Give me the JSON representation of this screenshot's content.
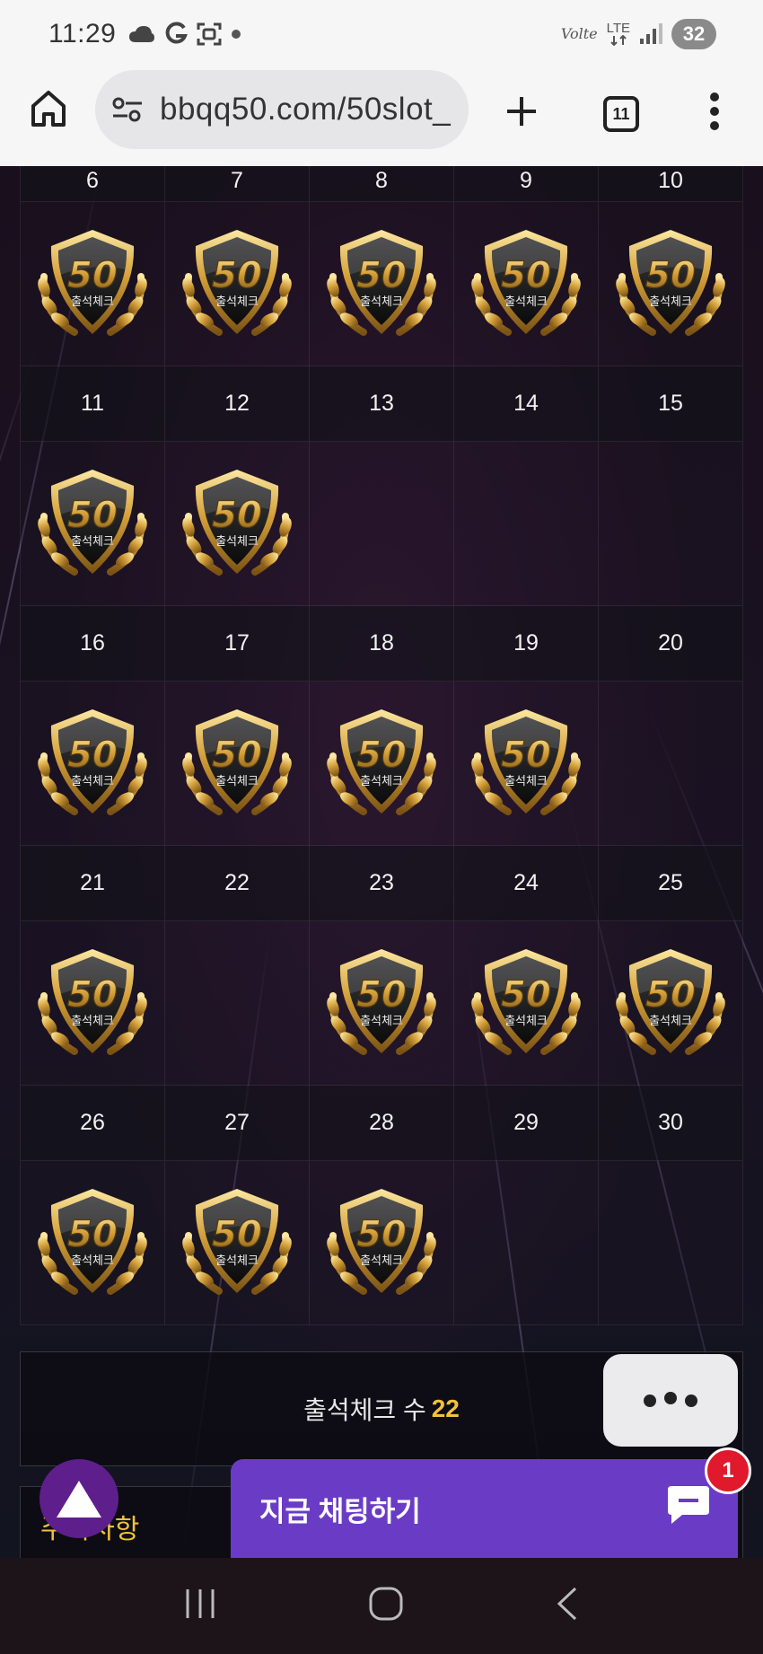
{
  "status_bar": {
    "time": "11:29",
    "network": "LTE",
    "volte": "Volte",
    "battery": "32"
  },
  "browser": {
    "url": "bbqq50.com/50slot_",
    "tab_count": "11"
  },
  "calendar": {
    "partial_header": [
      "6",
      "7",
      "8",
      "9",
      "10"
    ],
    "partial_checked": [
      true,
      true,
      true,
      true,
      true
    ],
    "weeks": [
      {
        "days": [
          "11",
          "12",
          "13",
          "14",
          "15"
        ],
        "checked": [
          true,
          true,
          false,
          false,
          false
        ]
      },
      {
        "days": [
          "16",
          "17",
          "18",
          "19",
          "20"
        ],
        "checked": [
          true,
          true,
          true,
          true,
          false
        ]
      },
      {
        "days": [
          "21",
          "22",
          "23",
          "24",
          "25"
        ],
        "checked": [
          true,
          false,
          true,
          true,
          true
        ]
      },
      {
        "days": [
          "26",
          "27",
          "28",
          "29",
          "30"
        ],
        "checked": [
          true,
          true,
          true,
          false,
          false
        ]
      }
    ],
    "badge": {
      "number": "50",
      "label": "출석체크"
    }
  },
  "summary": {
    "label": "출석체크 수",
    "count": "22"
  },
  "notice": {
    "title": "주의사항"
  },
  "chat": {
    "label": "지금 채팅하기",
    "unread": "1"
  },
  "colors": {
    "accent_gold": "#f3c13a",
    "chat_purple": "#6a3cc5",
    "badge_red": "#e0192c"
  }
}
